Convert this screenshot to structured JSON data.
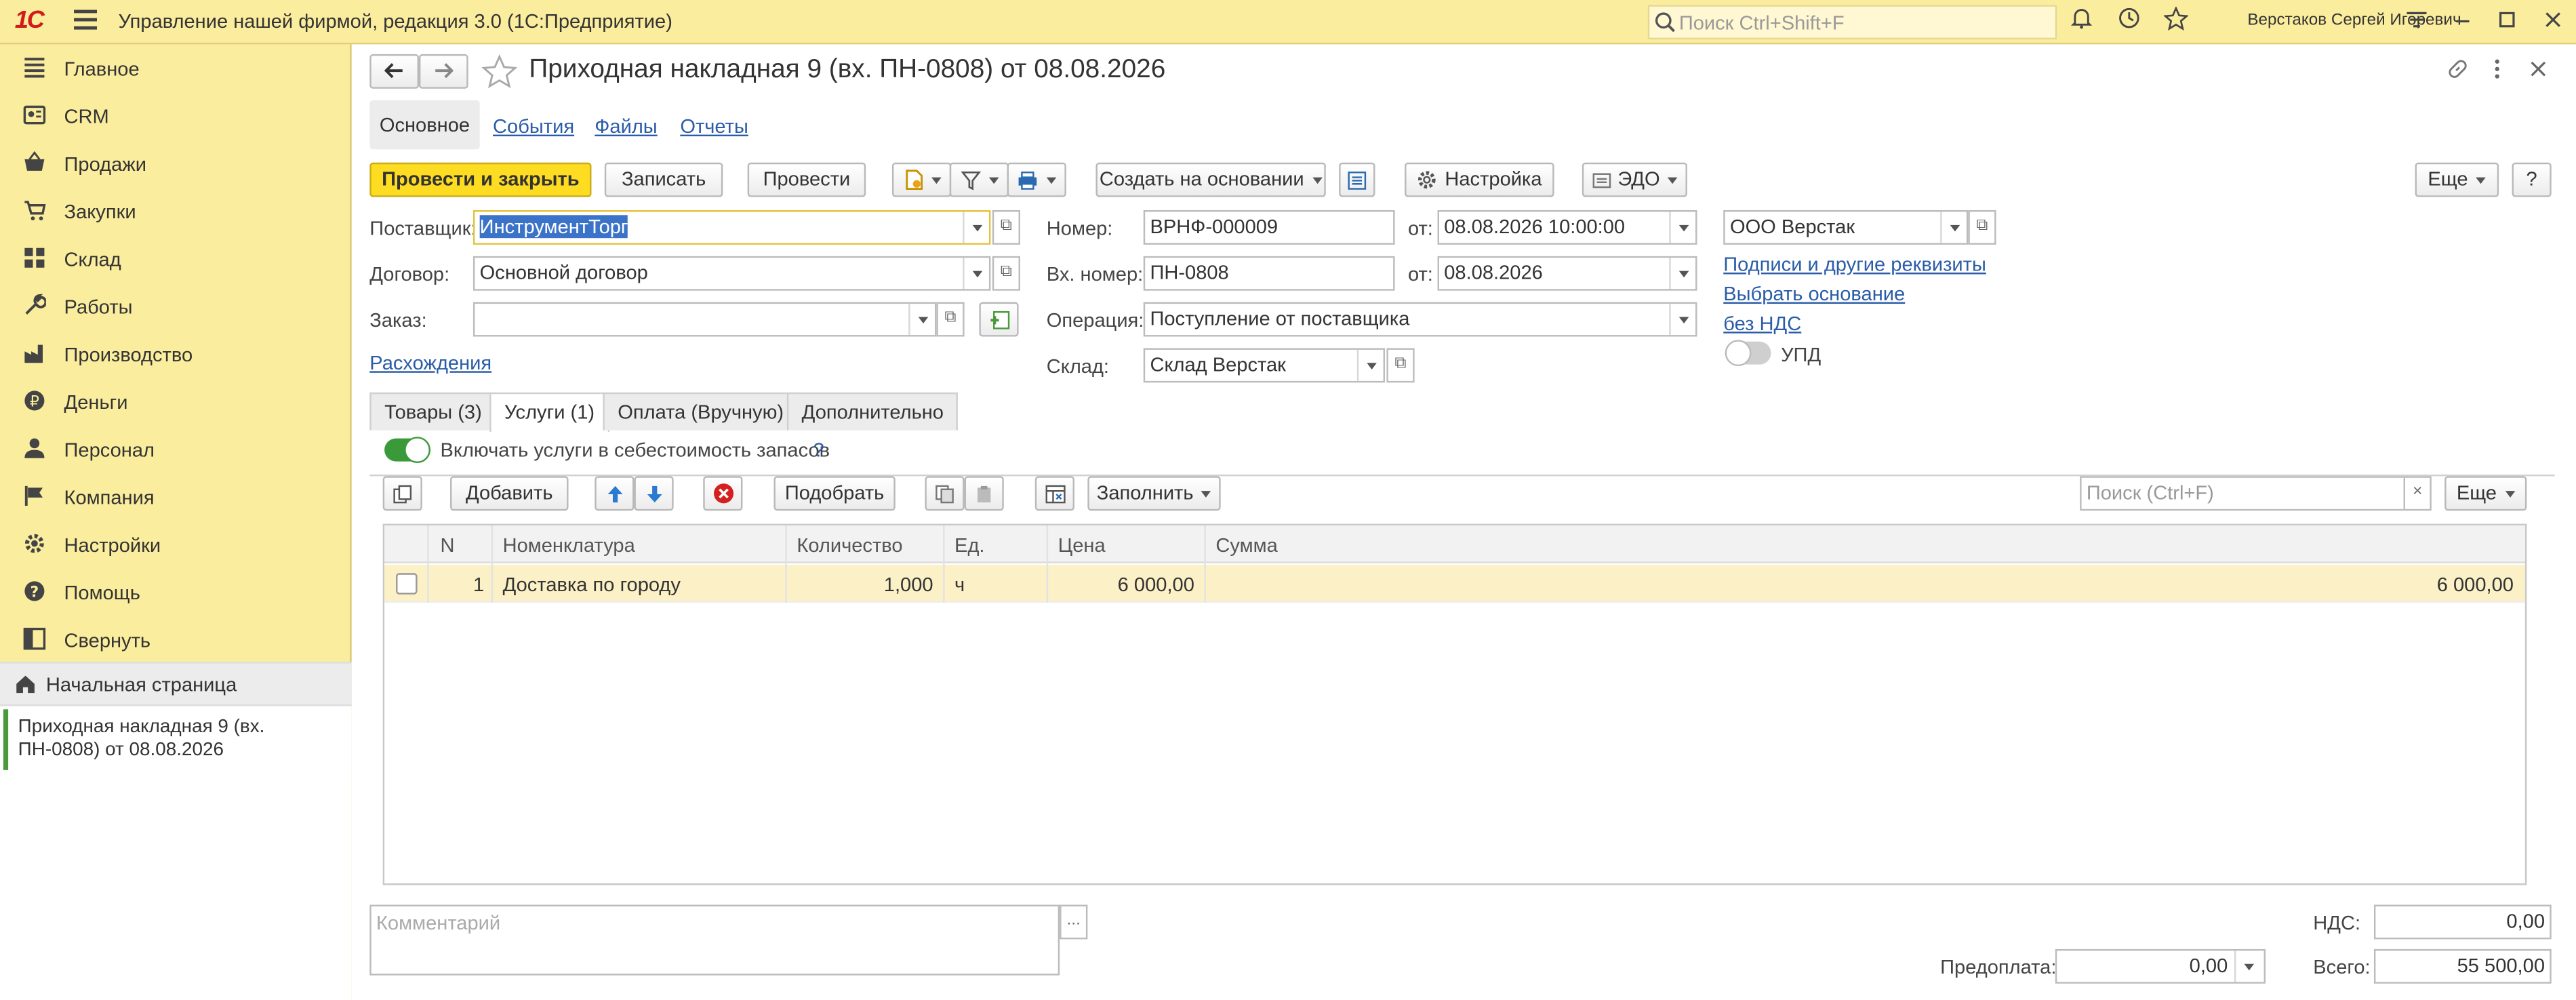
{
  "titlebar": {
    "logo": "1С",
    "app_title": "Управление нашей фирмой, редакция 3.0  (1С:Предприятие)",
    "search_placeholder": "Поиск Ctrl+Shift+F",
    "user": "Верстаков Сергей Игоревич"
  },
  "sidebar": {
    "items": [
      {
        "label": "Главное",
        "icon": "list-icon"
      },
      {
        "label": "CRM",
        "icon": "crm-icon"
      },
      {
        "label": "Продажи",
        "icon": "basket-icon"
      },
      {
        "label": "Закупки",
        "icon": "cart-icon"
      },
      {
        "label": "Склад",
        "icon": "warehouse-icon"
      },
      {
        "label": "Работы",
        "icon": "wrench-icon"
      },
      {
        "label": "Производство",
        "icon": "factory-icon"
      },
      {
        "label": "Деньги",
        "icon": "money-icon"
      },
      {
        "label": "Персонал",
        "icon": "person-icon"
      },
      {
        "label": "Компания",
        "icon": "flag-icon"
      },
      {
        "label": "Настройки",
        "icon": "gear-icon"
      },
      {
        "label": "Помощь",
        "icon": "help-icon"
      },
      {
        "label": "Свернуть",
        "icon": "collapse-icon"
      }
    ],
    "home": "Начальная страница",
    "open_window": "Приходная накладная 9 (вх. ПН-0808) от 08.08.2026"
  },
  "form": {
    "title": "Приходная накладная 9 (вх. ПН-0808) от 08.08.2026",
    "sections": [
      "Основное",
      "События",
      "Файлы",
      "Отчеты"
    ],
    "toolbar": {
      "post_close": "Провести и закрыть",
      "save": "Записать",
      "post": "Провести",
      "create_based": "Создать на основании",
      "settings": "Настройка",
      "edo": "ЭДО",
      "more": "Еще",
      "help": "?"
    },
    "fields": {
      "supplier_label": "Поставщик:",
      "supplier": "ИнструментТорг",
      "contract_label": "Договор:",
      "contract": "Основной договор",
      "order_label": "Заказ:",
      "order": "",
      "discrepancies": "Расхождения",
      "number_label": "Номер:",
      "number": "ВРНФ-000009",
      "from_label": "от:",
      "date": "08.08.2026 10:00:00",
      "in_number_label": "Вх. номер:",
      "in_number": "ПН-0808",
      "in_date": "08.08.2026",
      "operation_label": "Операция:",
      "operation": "Поступление от поставщика",
      "warehouse_label": "Склад:",
      "warehouse": "Склад Верстак",
      "company": "ООО Верстак",
      "signatures_link": "Подписи и другие реквизиты",
      "basis_link": "Выбрать основание",
      "vat_link": "без НДС",
      "upd_label": "УПД"
    },
    "tabs": [
      "Товары (3)",
      "Услуги (1)",
      "Оплата (Вручную)",
      "Дополнительно"
    ],
    "include_services": "Включать услуги в себестоимость запасов",
    "include_services_help": "?",
    "grid_toolbar": {
      "add": "Добавить",
      "pick": "Подобрать",
      "fill": "Заполнить",
      "search_placeholder": "Поиск (Ctrl+F)",
      "more": "Еще"
    },
    "grid": {
      "headers": [
        "N",
        "Номенклатура",
        "Количество",
        "Ед.",
        "Цена",
        "Сумма"
      ],
      "rows": [
        {
          "n": "1",
          "item": "Доставка по городу",
          "qty": "1,000",
          "unit": "ч",
          "price": "6 000,00",
          "sum": "6 000,00"
        }
      ]
    },
    "footer": {
      "comment_placeholder": "Комментарий",
      "ellipsis": "...",
      "vat_label": "НДС:",
      "vat": "0,00",
      "prepay_label": "Предоплата:",
      "prepay": "0,00",
      "total_label": "Всего:",
      "total": "55 500,00"
    }
  },
  "colors": {
    "titlebar": "#fbed9e",
    "primary_button": "#fddc21",
    "link": "#2a5ca8",
    "toggle_on": "#3a9a3a",
    "row_highlight": "#fbf0c6"
  }
}
